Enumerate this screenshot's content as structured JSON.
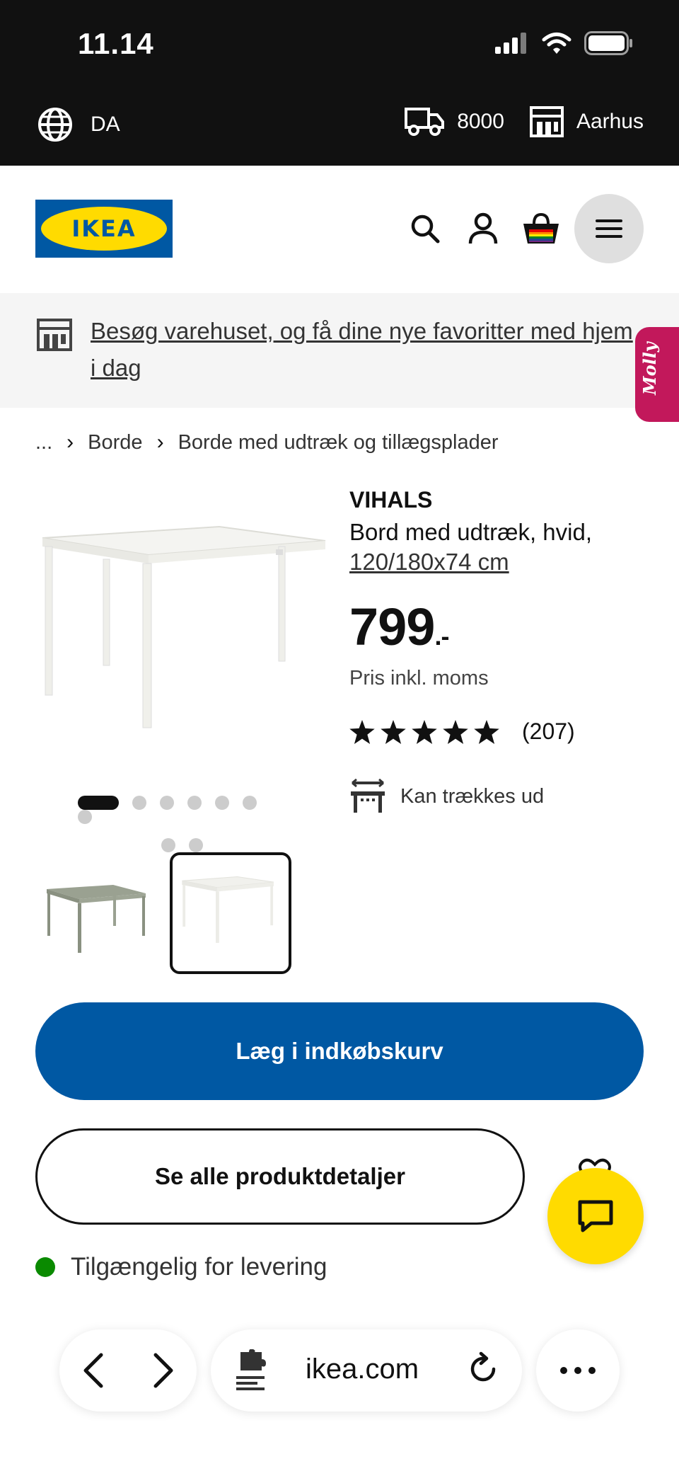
{
  "status_bar": {
    "time": "11.14"
  },
  "utility_bar": {
    "language": "DA",
    "postcode": "8000",
    "store": "Aarhus"
  },
  "header": {
    "logo_text": "IKEA"
  },
  "store_banner": {
    "text": "Besøg varehuset, og få dine nye favoritter med hjem i dag",
    "side_tab": "Molly"
  },
  "breadcrumb": {
    "items": [
      "...",
      "Borde",
      "Borde med udtræk og tillægsplader"
    ]
  },
  "product": {
    "name": "VIHALS",
    "description": "Bord med udtræk, hvid,",
    "dimensions": "120/180x74 cm",
    "price": "799",
    "price_suffix": ".-",
    "price_note": "Pris inkl. moms",
    "rating_stars": 5,
    "review_count": "(207)",
    "feature": "Kan trækkes ud",
    "carousel": {
      "total_dots": 9,
      "active_index": 0
    }
  },
  "buttons": {
    "add_to_cart": "Læg i indkøbskurv",
    "see_details": "Se alle produktdetaljer"
  },
  "availability": {
    "text": "Tilgængelig for levering",
    "status_color": "#0a8a00"
  },
  "browser": {
    "url": "ikea.com"
  },
  "colors": {
    "brand_blue": "#0058a3",
    "brand_yellow": "#ffdb00"
  }
}
